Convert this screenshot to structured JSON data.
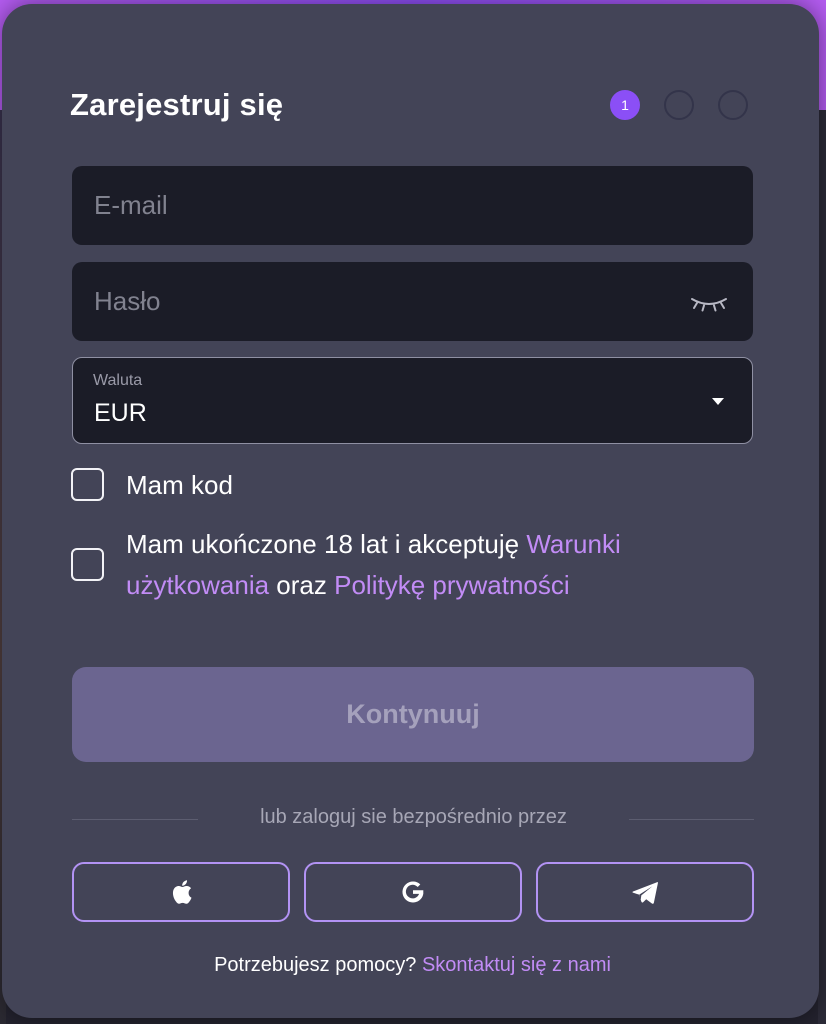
{
  "signup": {
    "title": "Zarejestruj się",
    "steps": [
      "1",
      "",
      ""
    ],
    "email": {
      "placeholder": "E-mail",
      "value": ""
    },
    "password": {
      "placeholder": "Hasło",
      "value": ""
    },
    "currency": {
      "label": "Waluta",
      "value": "EUR"
    },
    "promo_code": {
      "label": "Mam kod",
      "checked": false
    },
    "terms": {
      "prefix": "Mam ukończone 18 lat i akceptuję ",
      "terms_link": "Warunki użytkowania",
      "middle": " oraz ",
      "privacy_link": "Politykę prywatności",
      "checked": false
    },
    "continue_label": "Kontynuuj",
    "divider_text": "lub zaloguj sie bezpośrednio przez",
    "social_buttons": [
      {
        "icon": "apple-icon"
      },
      {
        "icon": "google-icon"
      },
      {
        "icon": "telegram-icon"
      }
    ],
    "help": {
      "question": "Potrzebujesz pomocy?",
      "link": "Skontaktuj się z nami"
    }
  },
  "colors": {
    "accent": "#8b4ff6",
    "link": "#c28cf6",
    "modal_bg": "#434457",
    "field_bg": "#1b1c27",
    "button_disabled": "#6b6590"
  }
}
